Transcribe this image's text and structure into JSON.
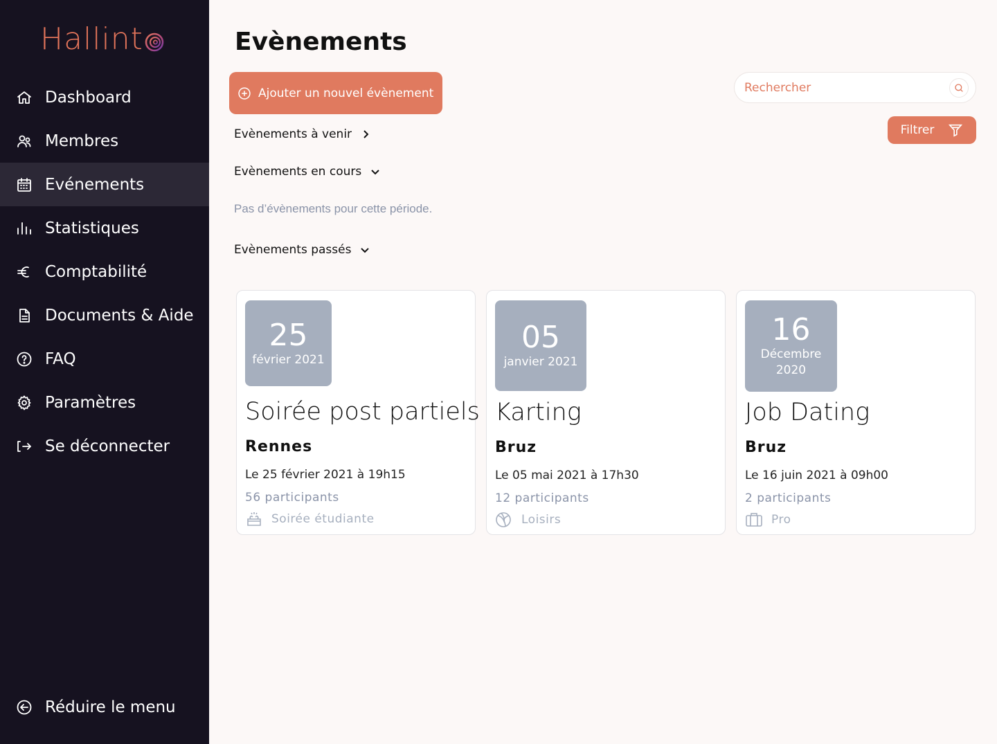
{
  "brand": {
    "name": "Hallint",
    "accent": "#e07a5f",
    "sidebar_bg": "#161220",
    "active_bg": "#2c2836"
  },
  "sidebar": {
    "items": [
      {
        "label": "Dashboard",
        "icon": "home-icon"
      },
      {
        "label": "Membres",
        "icon": "users-icon"
      },
      {
        "label": "Evénements",
        "icon": "calendar-icon",
        "active": true
      },
      {
        "label": "Statistiques",
        "icon": "bar-chart-icon"
      },
      {
        "label": "Comptabilité",
        "icon": "euro-icon"
      },
      {
        "label": "Documents & Aide",
        "icon": "document-icon"
      },
      {
        "label": "FAQ",
        "icon": "question-icon"
      },
      {
        "label": "Paramètres",
        "icon": "gear-icon"
      },
      {
        "label": "Se déconnecter",
        "icon": "logout-icon"
      }
    ],
    "collapse_label": "Réduire le menu"
  },
  "main": {
    "title": "Evènements",
    "add_button": "Ajouter un nouvel évènement",
    "search_placeholder": "Rechercher",
    "filter_label": "Filtrer",
    "sections": {
      "upcoming": "Evènements à venir",
      "ongoing": "Evènements en cours",
      "ongoing_empty": "Pas d’évènements pour cette période.",
      "past": "Evènements passés"
    }
  },
  "events": [
    {
      "day": "25",
      "month": "février 2021",
      "year": "",
      "title": "Soirée post partiels",
      "city": "Rennes",
      "datetime": "Le 25 février 2021 à 19h15",
      "participants": "56 participants",
      "category": "Soirée étudiante",
      "category_icon": "party-icon"
    },
    {
      "day": "05",
      "month": "janvier 2021",
      "year": "",
      "title": "Karting",
      "city": "Bruz",
      "datetime": "Le 05 mai 2021 à 17h30",
      "participants": "12 participants",
      "category": "Loisirs",
      "category_icon": "ball-icon"
    },
    {
      "day": "16",
      "month": "Décembre",
      "year": "2020",
      "title": "Job Dating",
      "city": "Bruz",
      "datetime": "Le 16 juin 2021 à 09h00",
      "participants": "2 participants",
      "category": "Pro",
      "category_icon": "briefcase-icon"
    }
  ]
}
